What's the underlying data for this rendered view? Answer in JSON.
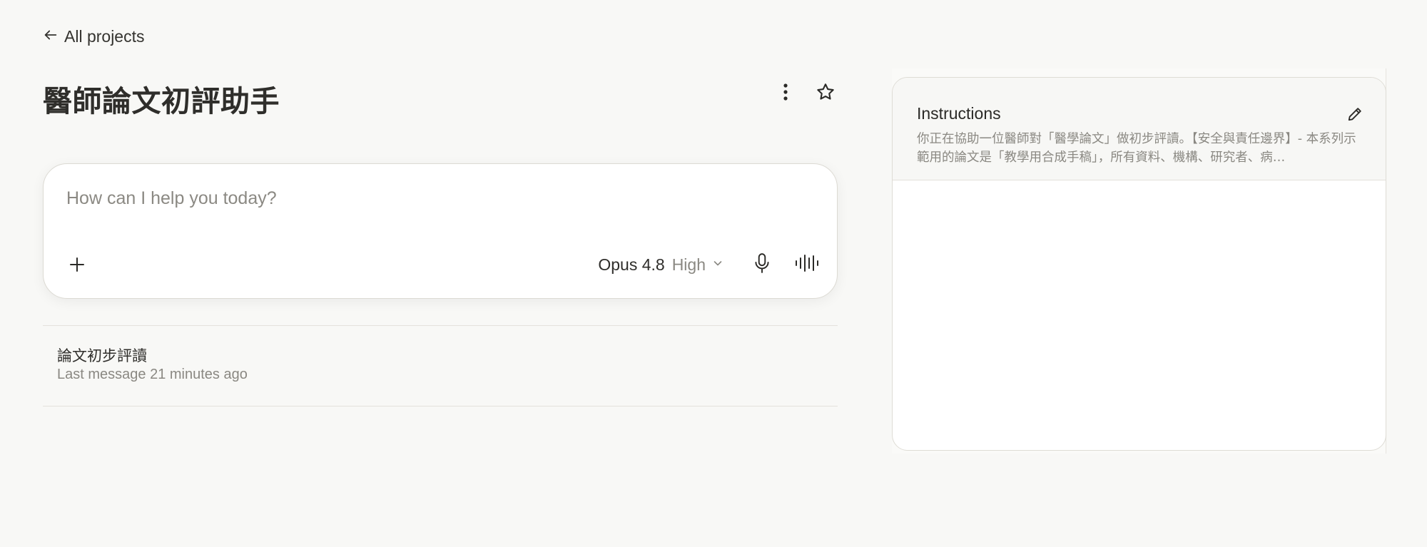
{
  "nav": {
    "back_label": "All projects"
  },
  "project": {
    "title": "醫師論文初評助手"
  },
  "composer": {
    "placeholder": "How can I help you today?",
    "model_name": "Opus 4.8",
    "effort_level": "High"
  },
  "chats": [
    {
      "title": "論文初步評讀",
      "meta": "Last message 21 minutes ago"
    }
  ],
  "instructions": {
    "title": "Instructions",
    "text": "你正在協助一位醫師對「醫學論文」做初步評讀。【安全與責任邊界】- 本系列示範用的論文是「教學用合成手稿」，所有資料、機構、研究者、病…"
  },
  "icons": {
    "back": "arrow-left-icon",
    "more": "more-vertical-icon",
    "star": "star-icon",
    "add": "plus-icon",
    "chevron": "chevron-down-icon",
    "mic": "microphone-icon",
    "voice": "voice-waveform-icon",
    "edit": "pencil-icon"
  },
  "colors": {
    "background": "#f8f8f6",
    "card": "#ffffff",
    "text_primary": "#2b2a27",
    "text_secondary": "#8a8882",
    "border": "#dcdad3"
  }
}
